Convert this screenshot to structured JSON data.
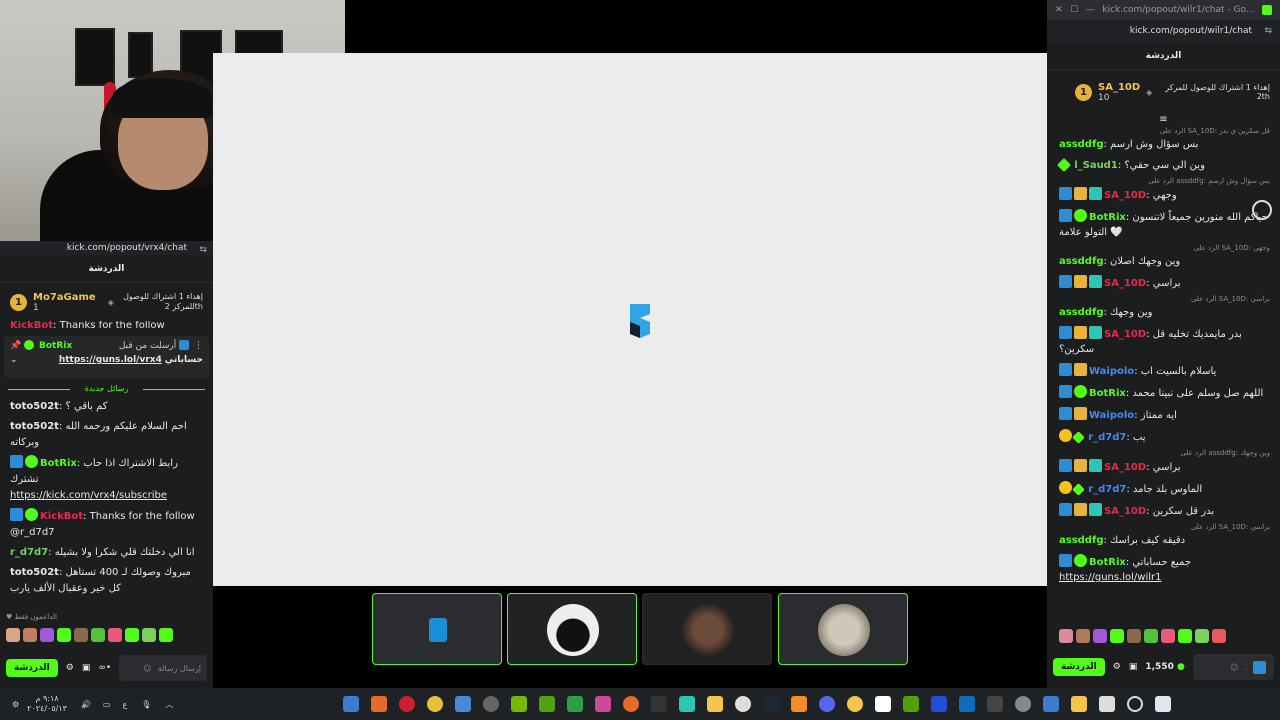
{
  "left_chat": {
    "url": "kick.com/popout/vrx4/chat",
    "title": "الدردشة",
    "sub_user": "Mo7aGame",
    "sub_count": "1",
    "sub_text": "إهداء 1 اشتراك للوصول للمركز 2",
    "sub_suffix": "th",
    "pinned_header": "أرسلت من قبل",
    "pinned_user": "BotRix",
    "pinned_prefix": "حساباتي",
    "pinned_link": "https://guns.lol/vrx4",
    "peek_user": "KickBot",
    "peek_text": "Thanks for the follow",
    "new_messages": "رسائل جديدة",
    "messages": [
      {
        "user": "toto502t",
        "text": "كم باقي ؟"
      },
      {
        "user": "toto502t",
        "text": "احم السلام عليكم ورحمه الله وبركاته"
      },
      {
        "user": "BotRix",
        "text": "رابط الاشتراك اذا حاب تشترك",
        "link": "https://kick.com/vrx4/subscribe"
      },
      {
        "user": "KickBot",
        "text": "Thanks for the follow @r_d7d7"
      },
      {
        "user": "r_d7d7",
        "text": "انا الي دخلتك قلي شكرا ولا بشيله"
      },
      {
        "user": "toto502t",
        "text": "مبروك وصولك لـ 400 تستاهل كل خير وعقبال الألف يارب"
      }
    ],
    "donors_label": "الداعمون فقط",
    "input_placeholder": "إرسال رسالة",
    "send_label": "الدردشة"
  },
  "cams": [
    "cam-1",
    "cam-2",
    "cam-3",
    "cam-4"
  ],
  "right_chat": {
    "window_title": "kick.com/popout/wilr1/chat - Go...",
    "url": "kick.com/popout/wilr1/chat",
    "title": "الدردشة",
    "sub_user": "SA_10D",
    "sub_count": "10",
    "sub_text": "إهداء 1 اشتراك للوصول للمركز 2",
    "sub_suffix": "th",
    "messages": [
      {
        "reply": "الرد على SA_10D: قل سكرين ي بدر",
        "user": "assddfg",
        "color": "green",
        "text": "بس سؤال وش ارسم"
      },
      {
        "user": "l_Saud1",
        "color": "lgreen",
        "text": "وين الي سي حقي؟"
      },
      {
        "reply": "الرد على assddfg: بس سؤال وش ارسم",
        "user": "SA_10D",
        "color": "red",
        "text": "وجهي"
      },
      {
        "user": "BotRix",
        "color": "green",
        "text": "حياكم الله منورين جميعاً لاتنسون التولو علامة 🤍"
      },
      {
        "reply": "الرد على SA_10D: وجهي",
        "user": "assddfg",
        "color": "green",
        "text": "وين وجهك اصلان"
      },
      {
        "user": "SA_10D",
        "color": "red",
        "text": "براسي"
      },
      {
        "reply": "الرد على SA_10D: براسي",
        "user": "assddfg",
        "color": "green",
        "text": "وين وجهك"
      },
      {
        "user": "SA_10D",
        "color": "red",
        "text": "بدر مايمديك تخليه قل سكرين؟"
      },
      {
        "user": "Waipolo",
        "color": "blue",
        "text": "ياسلام بالسيت اب"
      },
      {
        "user": "BotRix",
        "color": "green",
        "text": "اللهم صل وسلم على نبينا محمد"
      },
      {
        "user": "Waipolo",
        "color": "blue",
        "text": "ايه ممتاز"
      },
      {
        "user": "r_d7d7",
        "color": "blue",
        "text": "يب"
      },
      {
        "reply": "الرد على assddfg: وين وجهك",
        "user": "SA_10D",
        "color": "red",
        "text": "براسي"
      },
      {
        "user": "r_d7d7",
        "color": "blue",
        "text": "الماوس بلد جامد"
      },
      {
        "user": "SA_10D",
        "color": "red",
        "text": "بدر قل سكرين"
      },
      {
        "reply": "الرد على SA_10D: براسي",
        "user": "assddfg",
        "color": "green",
        "text": "دقيقه كيف براسك"
      },
      {
        "user": "BotRix",
        "color": "green",
        "text": "جميع حساباتي",
        "link": "https://guns.lol/wilr1"
      }
    ],
    "points": "1,550",
    "input_placeholder": ".",
    "send_label": "الدردشة"
  },
  "taskbar": {
    "time": "٩:١٨ م",
    "date": "٢٠٢٤/٠٥/١٣",
    "lang": "ع"
  }
}
